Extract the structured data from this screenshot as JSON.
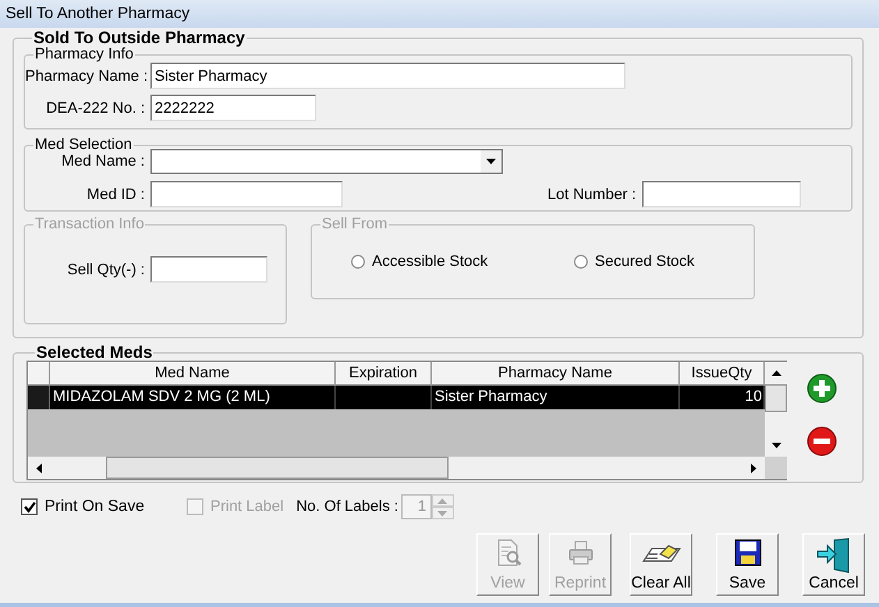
{
  "window": {
    "title": "Sell To Another Pharmacy"
  },
  "main_group": {
    "title": "Sold To Outside Pharmacy"
  },
  "pharmacy_info": {
    "title": "Pharmacy Info",
    "name": {
      "label": "Pharmacy Name :",
      "value": "Sister Pharmacy"
    },
    "dea": {
      "label": "DEA-222 No. :",
      "value": "2222222"
    }
  },
  "med_selection": {
    "title": "Med Selection",
    "med_name": {
      "label": "Med Name :"
    },
    "med_id": {
      "label": "Med ID :"
    },
    "lot_number": {
      "label": "Lot Number :"
    }
  },
  "transaction_info": {
    "title": "Transaction Info",
    "disabled": true,
    "sell_qty": {
      "label": "Sell Qty(-) :"
    }
  },
  "sell_from": {
    "title": "Sell From",
    "options": [
      {
        "label": "Accessible Stock",
        "selected": false
      },
      {
        "label": "Secured Stock",
        "selected": false
      }
    ]
  },
  "selected_meds": {
    "title": "Selected Meds",
    "columns": [
      "Med Name",
      "Expiration",
      "Pharmacy Name",
      "IssueQty"
    ],
    "rows": [
      {
        "med_name": "MIDAZOLAM SDV 2 MG (2 ML)",
        "pharmacy_name": "Sister Pharmacy",
        "issue_qty": "10",
        "selected": true
      }
    ]
  },
  "print_on_save": {
    "label": "Print On Save",
    "checked": true,
    "disabled": false
  },
  "print_label": {
    "label": "Print Label",
    "checked": false,
    "disabled": true
  },
  "labels_count": {
    "label": "No. Of Labels :",
    "value": "1"
  },
  "buttons": [
    {
      "kind": "view",
      "label": "View",
      "disabled": true
    },
    {
      "kind": "reprint",
      "label": "Reprint",
      "disabled": true
    },
    {
      "kind": "clear",
      "label": "Clear All",
      "disabled": false
    },
    {
      "kind": "save",
      "label": "Save",
      "disabled": false
    },
    {
      "kind": "cancel",
      "label": "Cancel",
      "disabled": false
    }
  ]
}
